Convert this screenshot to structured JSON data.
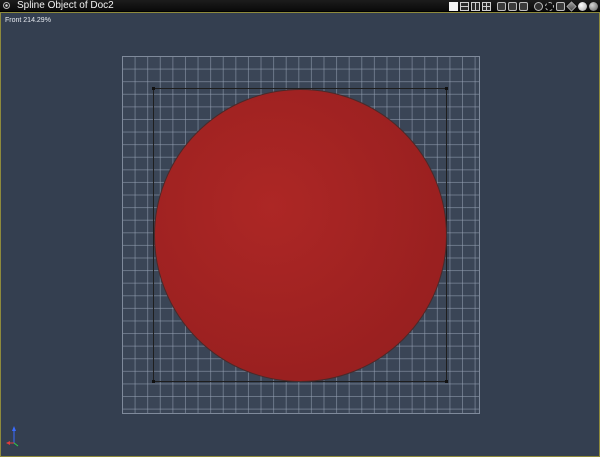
{
  "window": {
    "title": "Spline Object of Doc2"
  },
  "viewport": {
    "label": "Front 214.29%"
  },
  "toolbar": {
    "icons": [
      "single-view-icon",
      "two-view-horizontal-icon",
      "two-view-vertical-icon",
      "four-view-icon",
      "camera-ortho-icon",
      "camera-persp-icon",
      "camera-top-icon",
      "move-icon",
      "display-wire-icon",
      "display-box-icon",
      "display-cube-icon",
      "shading-white-icon",
      "shading-gray-icon"
    ]
  },
  "colors": {
    "viewport_bg": "#343f50",
    "shape_fill": "#a32322",
    "frame_border": "#8e8a3c"
  }
}
